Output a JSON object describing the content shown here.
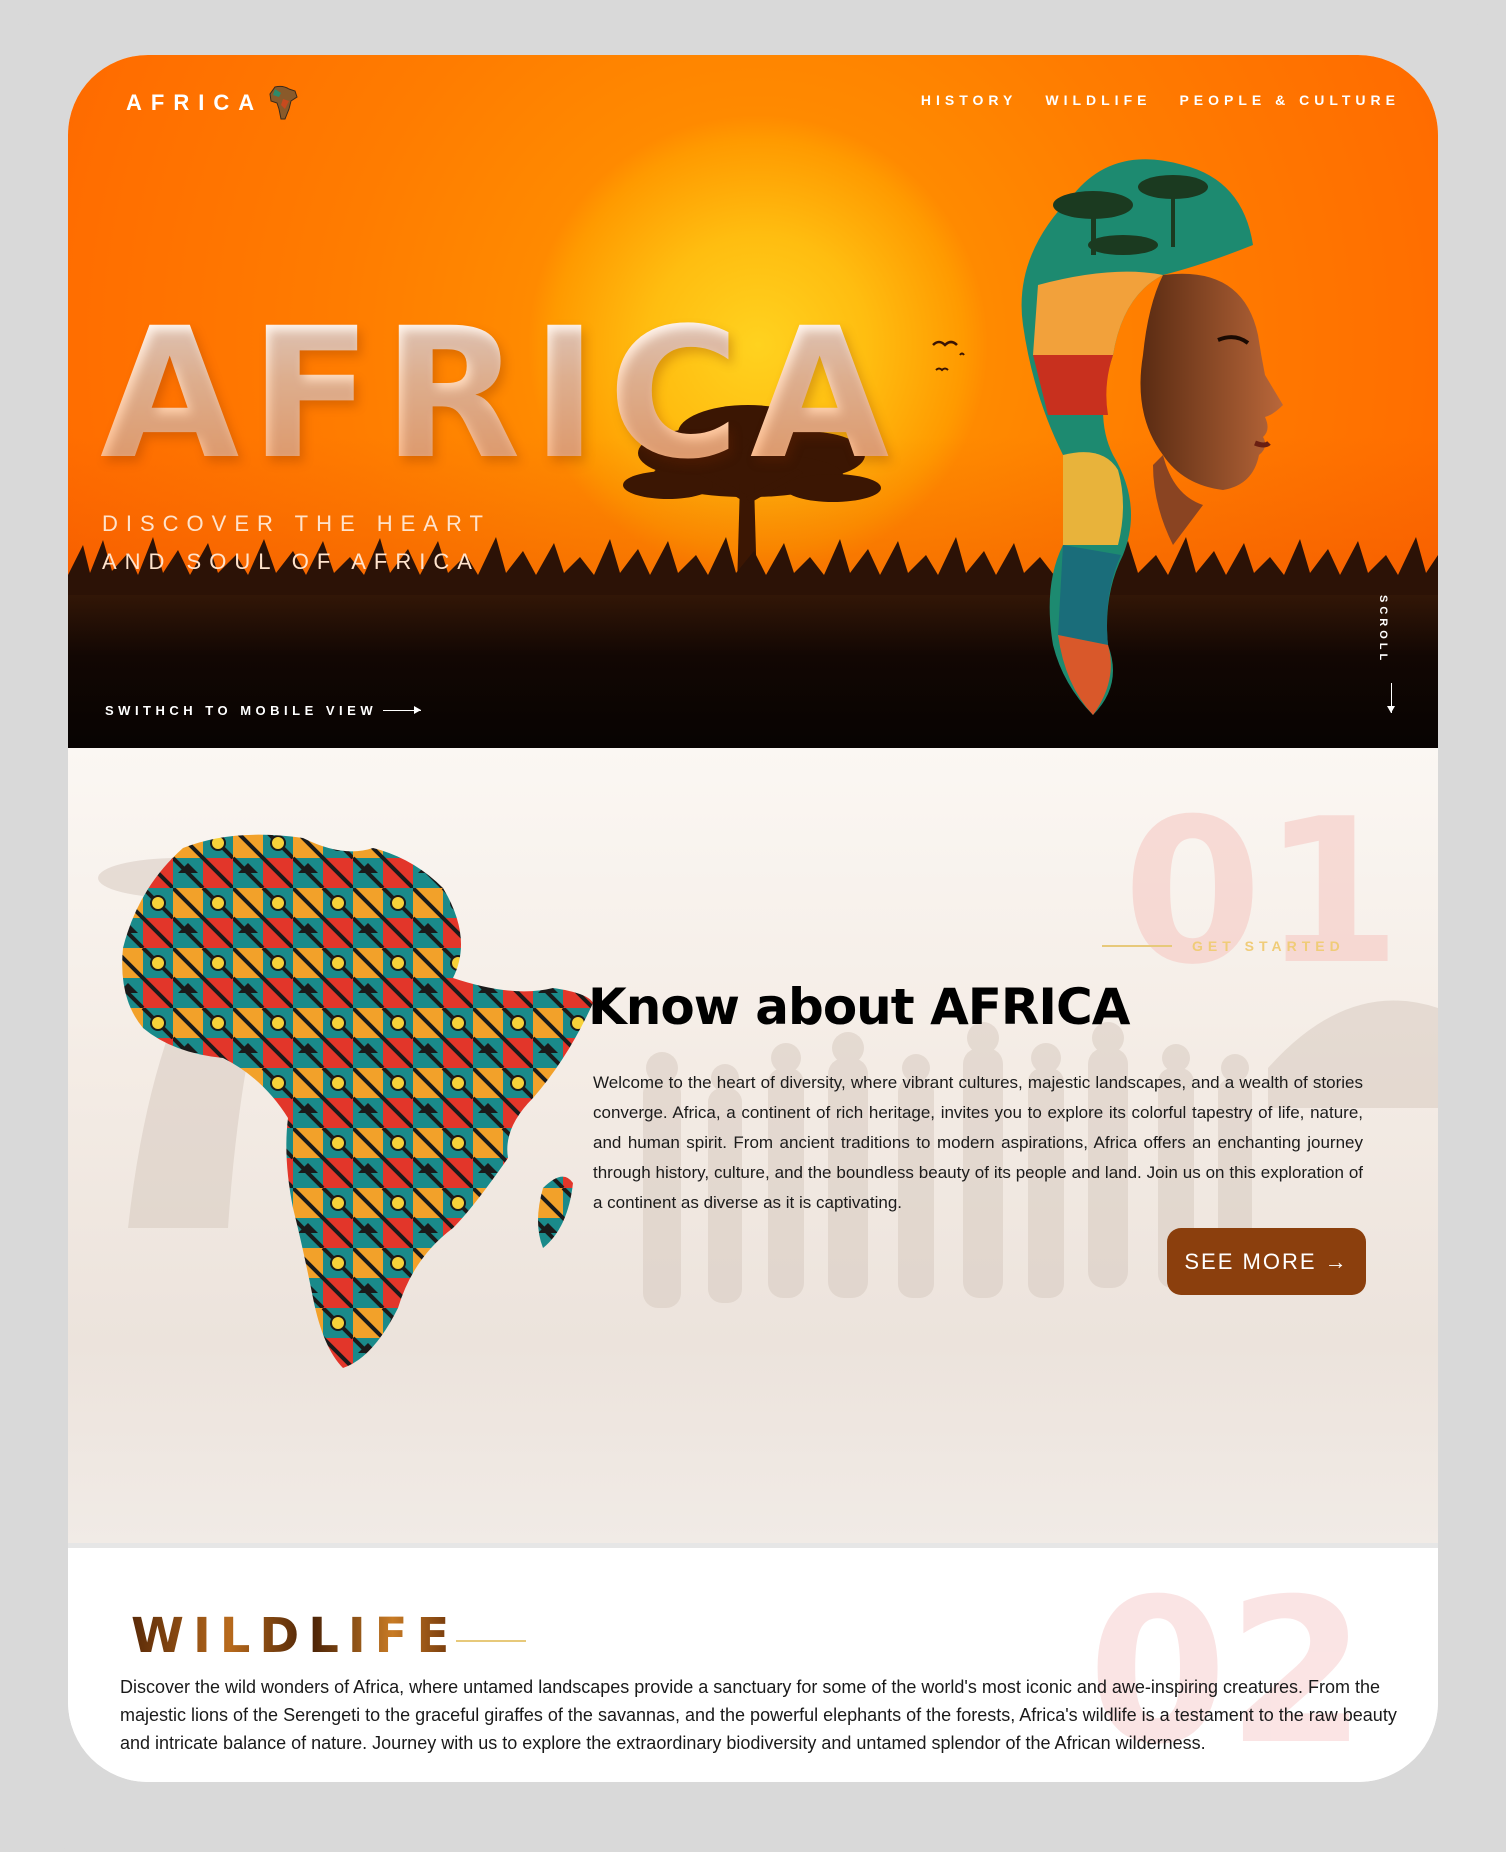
{
  "nav": {
    "logo": "AFRICA",
    "links": [
      "HISTORY",
      "WILDLIFE",
      "PEOPLE & CULTURE"
    ]
  },
  "hero": {
    "title": "AFRICA",
    "subtitle_line1": "DISCOVER THE HEART",
    "subtitle_line2": "AND SOUL OF AFRICA",
    "switch_label": "SWITHCH TO MOBILE VIEW",
    "scroll_label": "SCROLL"
  },
  "about": {
    "number": "01",
    "eyebrow": "GET STARTED",
    "title": "Know about AFRICA",
    "body": "Welcome to the heart of diversity, where vibrant cultures, majestic landscapes, and a wealth of stories converge. Africa, a continent of rich heritage, invites you to explore its colorful tapestry of life, nature, and human spirit. From ancient traditions to modern aspirations, Africa offers an enchanting journey through history, culture, and the boundless beauty of its people and land. Join us on this exploration of a continent as diverse as it is captivating.",
    "button": "SEE MORE →"
  },
  "wildlife": {
    "number": "02",
    "title": "WILDLIFE",
    "body": "Discover the wild wonders of Africa, where untamed landscapes provide a sanctuary for some of the world's most iconic and awe-inspiring creatures. From the majestic lions of the Serengeti to the graceful giraffes of the savannas, and the powerful elephants of the forests, Africa's wildlife is a testament to the raw beauty and intricate balance of nature. Journey with us to explore the extraordinary biodiversity and untamed splendor of the African wilderness."
  },
  "colors": {
    "hero_orange": "#ff7c00",
    "sun": "#ffd21f",
    "button_brown": "#8b3f0d",
    "accent_gold": "#f0cc78"
  }
}
